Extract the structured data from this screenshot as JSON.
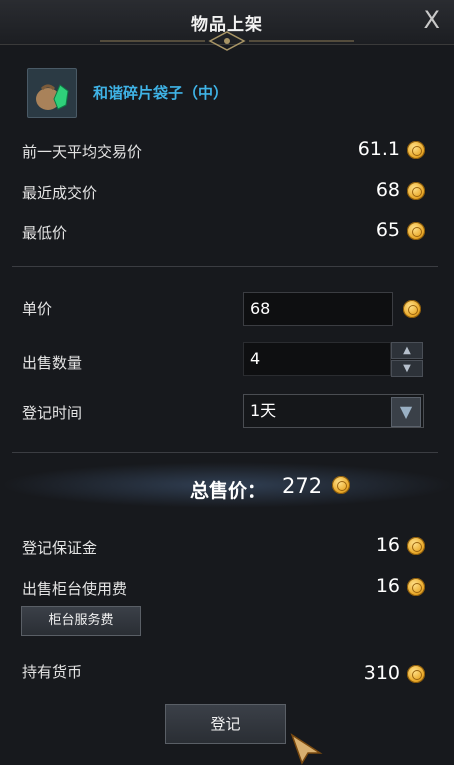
{
  "window": {
    "title": "物品上架",
    "close_label": "X"
  },
  "item": {
    "name": "和谐碎片袋子（中）",
    "icon": "pouch-with-green-crystal-icon"
  },
  "price_info": {
    "avg_label": "前一天平均交易价",
    "avg_value": "61.1",
    "recent_label": "最近成交价",
    "recent_value": "68",
    "min_label": "最低价",
    "min_value": "65"
  },
  "form": {
    "unit_price_label": "单价",
    "unit_price_value": "68",
    "quantity_label": "出售数量",
    "quantity_value": "4",
    "duration_label": "登记时间",
    "duration_value": "1天"
  },
  "total": {
    "label": "总售价：",
    "value": "272"
  },
  "fees": {
    "deposit_label": "登记保证金",
    "deposit_value": "16",
    "counter_fee_label": "出售柜台使用费",
    "counter_fee_value": "16",
    "service_button": "柜台服务费"
  },
  "wallet": {
    "label": "持有货币",
    "value": "310"
  },
  "actions": {
    "register_button": "登记"
  },
  "colors": {
    "item_name": "#3fb3e6",
    "coin": "#e9a92a",
    "background": "#17191d"
  }
}
